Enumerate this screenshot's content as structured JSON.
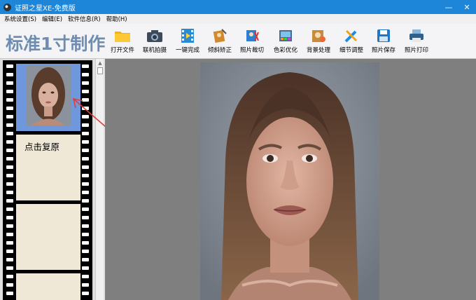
{
  "window": {
    "title": "证照之星XE-免费版",
    "controls": {
      "minimize": "—",
      "close": "✕"
    }
  },
  "menu": [
    "系统设置(S)",
    "编辑(E)",
    "软件信息(R)",
    "帮助(H)"
  ],
  "brand": "标准1寸制作",
  "toolbar": [
    {
      "label": "打开文件",
      "icon": "folder-icon"
    },
    {
      "label": "联机拍摄",
      "icon": "camera-icon"
    },
    {
      "label": "一键完成",
      "icon": "film-play-icon"
    },
    {
      "label": "倾斜矫正",
      "icon": "tilt-correct-icon"
    },
    {
      "label": "照片裁切",
      "icon": "crop-icon"
    },
    {
      "label": "色彩优化",
      "icon": "color-optimize-icon"
    },
    {
      "label": "背景处理",
      "icon": "background-icon"
    },
    {
      "label": "细节调整",
      "icon": "detail-adjust-icon"
    },
    {
      "label": "照片保存",
      "icon": "save-icon"
    },
    {
      "label": "照片打印",
      "icon": "printer-icon"
    }
  ],
  "filmstrip": {
    "restore_label": "点击复原"
  },
  "colors": {
    "titlebar": "#1e86d9",
    "brand": "#6d8db3",
    "arrow": "#e23b3b"
  }
}
